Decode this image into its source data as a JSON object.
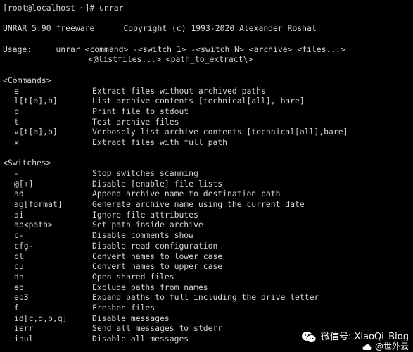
{
  "prompt_line": "[root@localhost ~]# unrar",
  "version_line": "UNRAR 5.90 freeware      Copyright (c) 1993-2020 Alexander Roshal",
  "usage_line1": "Usage:     unrar <command> -<switch 1> -<switch N> <archive> <files...>",
  "usage_line2": "<@listfiles...> <path_to_extract\\>",
  "commands_header": "<Commands>",
  "commands": [
    {
      "cmd": "e",
      "desc": "Extract files without archived paths"
    },
    {
      "cmd": "l[t[a],b]",
      "desc": "List archive contents [technical[all], bare]"
    },
    {
      "cmd": "p",
      "desc": "Print file to stdout"
    },
    {
      "cmd": "t",
      "desc": "Test archive files"
    },
    {
      "cmd": "v[t[a],b]",
      "desc": "Verbosely list archive contents [technical[all],bare]"
    },
    {
      "cmd": "x",
      "desc": "Extract files with full path"
    }
  ],
  "switches_header": "<Switches>",
  "switches": [
    {
      "cmd": "-",
      "desc": "Stop switches scanning"
    },
    {
      "cmd": "@[+]",
      "desc": "Disable [enable] file lists"
    },
    {
      "cmd": "ad",
      "desc": "Append archive name to destination path"
    },
    {
      "cmd": "ag[format]",
      "desc": "Generate archive name using the current date"
    },
    {
      "cmd": "ai",
      "desc": "Ignore file attributes"
    },
    {
      "cmd": "ap<path>",
      "desc": "Set path inside archive"
    },
    {
      "cmd": "c-",
      "desc": "Disable comments show"
    },
    {
      "cmd": "cfg-",
      "desc": "Disable read configuration"
    },
    {
      "cmd": "cl",
      "desc": "Convert names to lower case"
    },
    {
      "cmd": "cu",
      "desc": "Convert names to upper case"
    },
    {
      "cmd": "dh",
      "desc": "Open shared files"
    },
    {
      "cmd": "ep",
      "desc": "Exclude paths from names"
    },
    {
      "cmd": "ep3",
      "desc": "Expand paths to full including the drive letter"
    },
    {
      "cmd": "f",
      "desc": "Freshen files"
    },
    {
      "cmd": "id[c,d,p,q]",
      "desc": "Disable messages"
    },
    {
      "cmd": "ierr",
      "desc": "Send all messages to stderr"
    },
    {
      "cmd": "inul",
      "desc": "Disable all messages"
    }
  ],
  "watermark": {
    "line1": "微信号: XiaoQi_Blog",
    "line2": "@世外云",
    "icon_wechat": "wechat-icon",
    "icon_cloud": "cloud-icon"
  },
  "colors": {
    "background": "#000000",
    "text": "#d6d6d6"
  }
}
